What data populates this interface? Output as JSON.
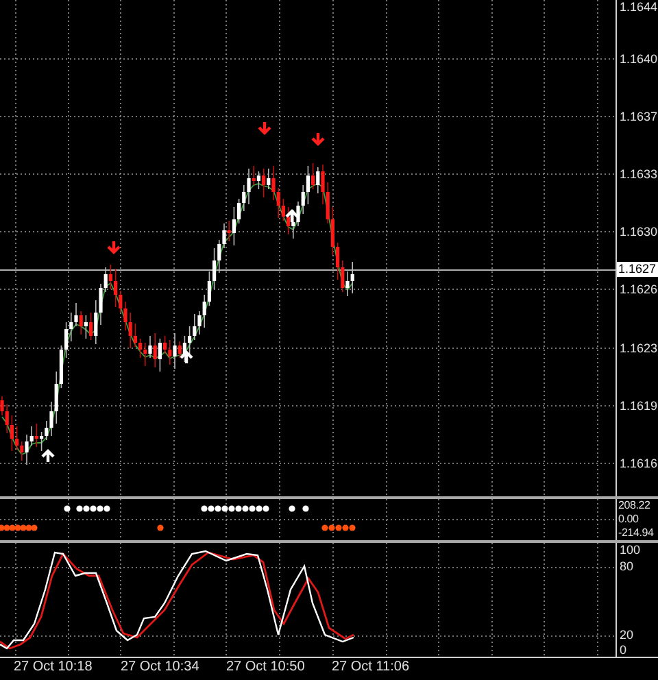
{
  "main_pane": {
    "price_ticks": [
      "1.1644",
      "1.1640",
      "1.1637",
      "1.1633",
      "1.1630",
      "1.1626",
      "1.1623",
      "1.1619",
      "1.1616"
    ],
    "current_price": "1.1627"
  },
  "signal_pane": {
    "ticks": [
      "208.22",
      "0.00",
      "-214.94"
    ]
  },
  "stochastic_pane": {
    "ticks": [
      "100",
      "80",
      "20",
      "0"
    ]
  },
  "time_axis": {
    "labels": [
      "27 Oct 10:18",
      "27 Oct 10:34",
      "27 Oct 10:50",
      "27 Oct 11:06"
    ]
  }
}
